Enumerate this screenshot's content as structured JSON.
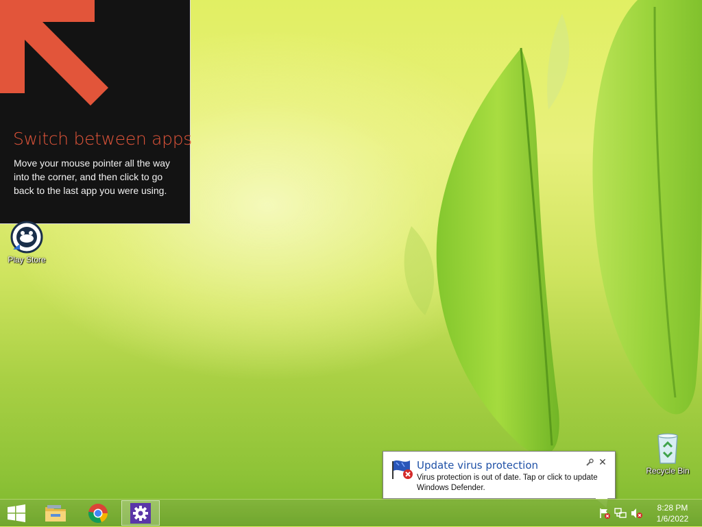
{
  "tip": {
    "title": "Switch between apps",
    "body": "Move your mouse pointer all the way into the corner, and then click to go back to the last app you were using.",
    "accent_color": "#e2553a"
  },
  "desktop": {
    "icons": [
      {
        "label": "Play Store",
        "icon": "play-store-icon"
      },
      {
        "label": "Recycle Bin",
        "icon": "recycle-bin-icon"
      }
    ]
  },
  "notification": {
    "title": "Update virus protection",
    "message": "Virus protection is out of date. Tap or click to update Windows Defender.",
    "icon": "defender-flag-icon",
    "close_label": "✕"
  },
  "taskbar": {
    "pinned": [
      {
        "name": "start-button",
        "icon": "windows-logo-icon"
      },
      {
        "name": "file-explorer",
        "icon": "folder-icon"
      },
      {
        "name": "chrome",
        "icon": "chrome-icon"
      },
      {
        "name": "settings",
        "icon": "gear-icon",
        "active": true
      }
    ],
    "tray": [
      "action-center-flag-icon",
      "network-icon",
      "volume-muted-icon"
    ],
    "clock": {
      "time": "8:28 PM",
      "date": "1/6/2022"
    }
  }
}
